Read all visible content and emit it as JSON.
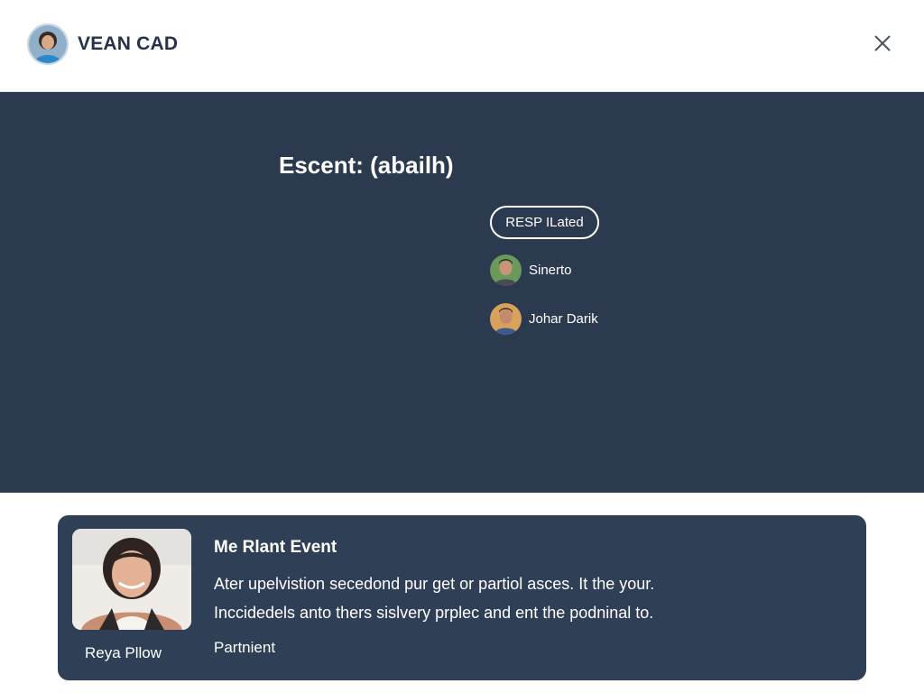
{
  "header": {
    "title": "VEAN CAD",
    "avatar_icon": "user-avatar-icon",
    "close_icon": "close-icon"
  },
  "event": {
    "title": "Escent:  (abailh)",
    "rsvp_label": "RESP ILated",
    "attendees": [
      {
        "name": "Sinerto"
      },
      {
        "name": "Johar Darik"
      }
    ]
  },
  "card": {
    "person_name": "Reya Pllow",
    "heading": "Me Rlant Event",
    "line1": "Ater upelvistion secedond pur get or partiol asces. It the your.",
    "line2": "Inccidedels anto thers sislvery prplec and ent the podninal to.",
    "link": "Partnient"
  },
  "colors": {
    "panel": "#2c3a4f",
    "card": "#2f3f55",
    "header_text": "#26324a"
  }
}
